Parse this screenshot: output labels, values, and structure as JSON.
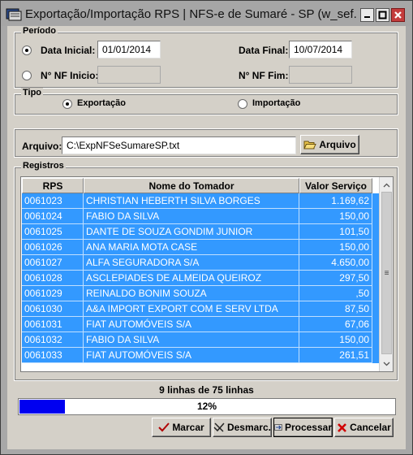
{
  "window": {
    "title": "Exportação/Importação RPS  |  NFS-e de Sumaré - SP (w_sef..."
  },
  "periodo": {
    "group_title": "Período",
    "data_inicial_label": "Data Inicial:",
    "data_inicial_value": "01/01/2014",
    "data_final_label": "Data Final:",
    "data_final_value": "10/07/2014",
    "nf_inicio_label": "N° NF Inicio:",
    "nf_inicio_value": "",
    "nf_fim_label": "N° NF Fim:",
    "nf_fim_value": ""
  },
  "tipo": {
    "group_title": "Tipo",
    "exportacao_label": "Exportação",
    "importacao_label": "Importação",
    "selected": "Exportação"
  },
  "arquivo": {
    "label": "Arquivo:",
    "value": "C:\\ExpNFSeSumareSP.txt",
    "button_label": "Arquivo"
  },
  "registros": {
    "group_title": "Registros",
    "columns": [
      "RPS",
      "Nome do Tomador",
      "Valor Serviço"
    ],
    "rows": [
      {
        "rps": "0061023",
        "nome": "CHRISTIAN HEBERTH SILVA  BORGES",
        "valor": "1.169,62"
      },
      {
        "rps": "0061024",
        "nome": "FABIO DA SILVA",
        "valor": "150,00"
      },
      {
        "rps": "0061025",
        "nome": "DANTE DE SOUZA GONDIM JUNIOR",
        "valor": "101,50"
      },
      {
        "rps": "0061026",
        "nome": "ANA MARIA MOTA CASE",
        "valor": "150,00"
      },
      {
        "rps": "0061027",
        "nome": "ALFA SEGURADORA S/A",
        "valor": "4.650,00"
      },
      {
        "rps": "0061028",
        "nome": "ASCLEPIADES DE ALMEIDA QUEIROZ",
        "valor": "297,50"
      },
      {
        "rps": "0061029",
        "nome": "REINALDO BONIM SOUZA",
        "valor": ",50"
      },
      {
        "rps": "0061030",
        "nome": "A&A IMPORT EXPORT COM E SERV LTDA",
        "valor": "87,50"
      },
      {
        "rps": "0061031",
        "nome": "FIAT AUTOMÓVEIS S/A",
        "valor": "67,06"
      },
      {
        "rps": "0061032",
        "nome": "FABIO DA SILVA",
        "valor": "150,00"
      },
      {
        "rps": "0061033",
        "nome": "FIAT AUTOMÓVEIS S/A",
        "valor": "261,51"
      }
    ]
  },
  "status": {
    "lines_text": "9 linhas de 75 linhas",
    "progress_percent": 12,
    "progress_text": "12%"
  },
  "buttons": {
    "marcar": "Marcar",
    "desmarcar": "Desmarc.",
    "processar": "Processar",
    "cancelar": "Cancelar"
  },
  "colors": {
    "selection": "#3399ff",
    "progress": "#0000f0"
  }
}
